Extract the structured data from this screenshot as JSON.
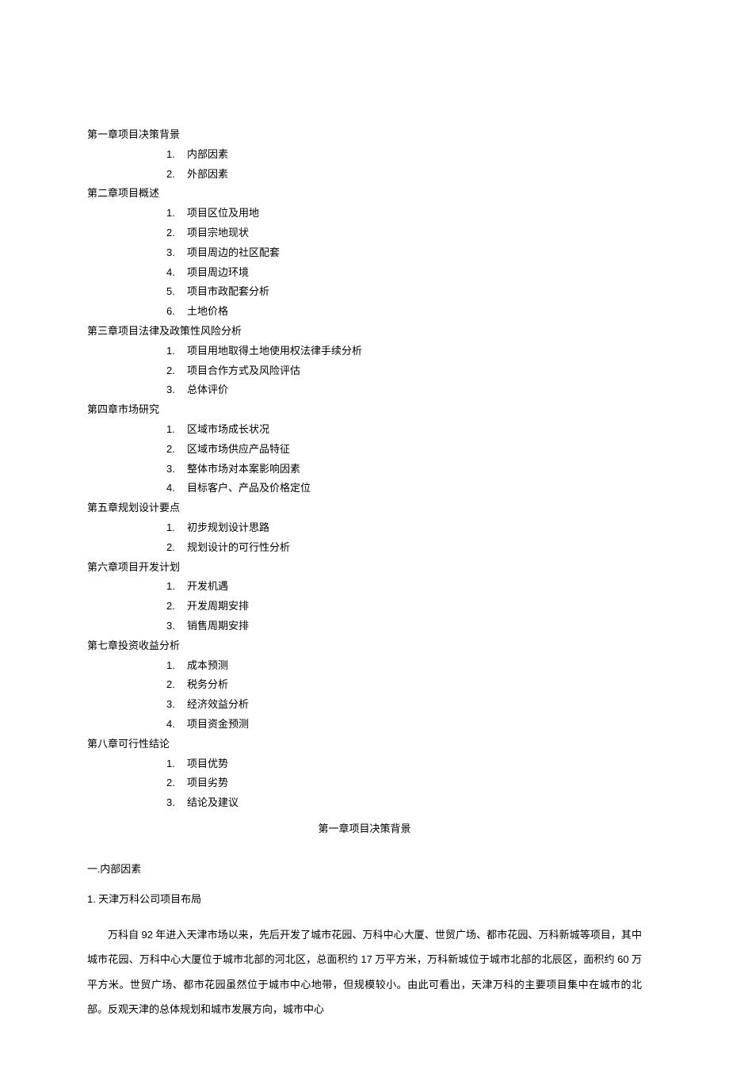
{
  "toc": [
    {
      "chapter": "第一章项目决策背景",
      "items": [
        {
          "num": "1.",
          "text": "内部因素"
        },
        {
          "num": "2.",
          "text": "外部因素"
        }
      ]
    },
    {
      "chapter": "第二章项目概述",
      "items": [
        {
          "num": "1.",
          "text": "项目区位及用地"
        },
        {
          "num": "2.",
          "text": "项目宗地现状"
        },
        {
          "num": "3.",
          "text": "项目周边的社区配套"
        },
        {
          "num": "4.",
          "text": "项目周边环境"
        },
        {
          "num": "5.",
          "text": "项目市政配套分析"
        },
        {
          "num": "6.",
          "text": "土地价格"
        }
      ]
    },
    {
      "chapter": "第三章项目法律及政策性风险分析",
      "items": [
        {
          "num": "1.",
          "text": "项目用地取得土地使用权法律手续分析"
        },
        {
          "num": "2.",
          "text": "项目合作方式及风险评估"
        },
        {
          "num": "3.",
          "text": "总体评价"
        }
      ]
    },
    {
      "chapter": "第四章市场研究",
      "items": [
        {
          "num": "1.",
          "text": "区域市场成长状况"
        },
        {
          "num": "2.",
          "text": "区域市场供应产品特征"
        },
        {
          "num": "3.",
          "text": "整体市场对本案影响因素"
        },
        {
          "num": "4.",
          "text": "目标客户、产品及价格定位"
        }
      ]
    },
    {
      "chapter": "第五章规划设计要点",
      "items": [
        {
          "num": "1.",
          "text": "初步规划设计思路"
        },
        {
          "num": "2.",
          "text": "规划设计的可行性分析"
        }
      ]
    },
    {
      "chapter": "第六章项目开发计划",
      "items": [
        {
          "num": "1.",
          "text": "开发机遇"
        },
        {
          "num": "2.",
          "text": "开发周期安排"
        },
        {
          "num": "3.",
          "text": "销售周期安排"
        }
      ]
    },
    {
      "chapter": "第七章投资收益分析",
      "items": [
        {
          "num": "1.",
          "text": "成本预测"
        },
        {
          "num": "2.",
          "text": "税务分析"
        },
        {
          "num": "3.",
          "text": "经济效益分析"
        },
        {
          "num": "4.",
          "text": "项目资金预测"
        }
      ]
    },
    {
      "chapter": "第八章可行性结论",
      "items": [
        {
          "num": "1.",
          "text": "项目优势"
        },
        {
          "num": "2.",
          "text": "项目劣势"
        },
        {
          "num": "3.",
          "text": "结论及建议"
        }
      ]
    }
  ],
  "body": {
    "centerTitle": "第一章项目决策背景",
    "section1Heading": "一.内部因素",
    "subsection1Heading_num": "1.",
    "subsection1Heading_text": " 天津万科公司项目布局",
    "paragraph_prefix": "万科自 ",
    "paragraph_num1": "92",
    "paragraph_mid1": " 年进入天津市场以来，先后开发了城市花园、万科中心大厦、世贸广场、都市花园、万科新城等项目，其中城市花园、万科中心大厦位于城市北部的河北区，总面积约 ",
    "paragraph_num2": "17",
    "paragraph_mid2": " 万平方米，万科新城位于城市北部的北辰区，面积约 ",
    "paragraph_num3": "60",
    "paragraph_suffix": " 万平方米。世贸广场、都市花园虽然位于城市中心地带，但规模较小。由此可看出，天津万科的主要项目集中在城市的北部。反观天津的总体规划和城市发展方向，城市中心"
  }
}
